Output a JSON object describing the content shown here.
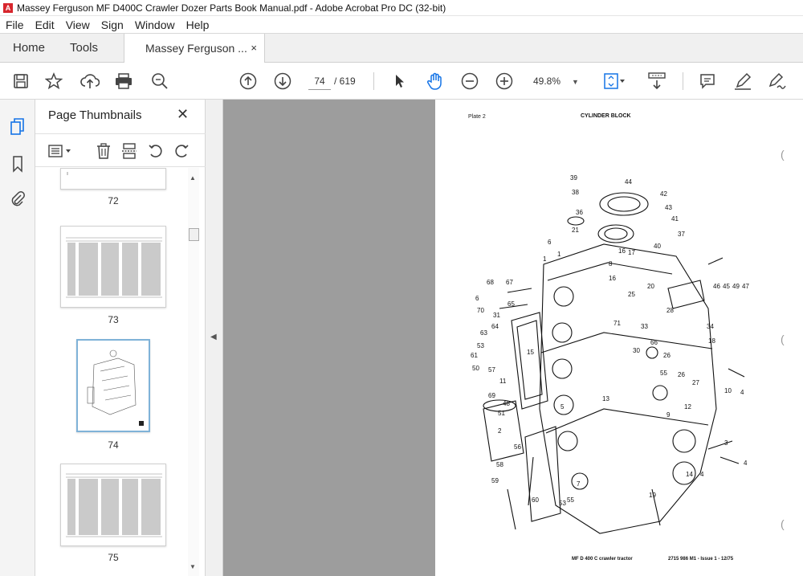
{
  "window": {
    "title": "Massey Ferguson MF D400C Crawler Dozer  Parts Book Manual.pdf - Adobe Acrobat Pro DC (32-bit)",
    "app_icon": "acrobat-icon"
  },
  "menu": [
    "File",
    "Edit",
    "View",
    "Sign",
    "Window",
    "Help"
  ],
  "tabs": {
    "home": "Home",
    "tools": "Tools",
    "document": "Massey Ferguson ...",
    "close": "×"
  },
  "toolbar": {
    "icons": [
      "save-icon",
      "bookmark-star-icon",
      "upload-cloud-icon",
      "print-icon",
      "zoom-search-icon",
      "page-up-icon",
      "page-down-icon",
      "select-pointer-icon",
      "hand-tool-icon",
      "zoom-out-icon",
      "zoom-in-icon",
      "fit-page-icon",
      "scrolling-mode-icon",
      "comment-icon",
      "highlight-pen-icon",
      "sign-icon"
    ],
    "current_page": "74",
    "total_pages": "/ 619",
    "zoom": "49.8%",
    "zoom_caret": "▼"
  },
  "sidebar": {
    "title": "Page Thumbnails",
    "close": "✕",
    "thumbnails": [
      {
        "label": "72"
      },
      {
        "label": "73"
      },
      {
        "label": "74",
        "selected": true
      },
      {
        "label": "75"
      }
    ]
  },
  "document_page": {
    "plate": "Plate 2",
    "heading": "CYLINDER BLOCK",
    "footer_left": "MF D 400 C crawler tractor",
    "footer_right": "2715 986 M1 - Issue 1 - 12/75",
    "callouts": [
      "39",
      "44",
      "38",
      "42",
      "43",
      "36",
      "41",
      "21",
      "37",
      "6",
      "17",
      "16",
      "40",
      "1",
      "8",
      "25",
      "20",
      "68",
      "67",
      "6",
      "70",
      "31",
      "65",
      "66",
      "33",
      "61",
      "53",
      "55",
      "15",
      "63",
      "64",
      "34",
      "18",
      "28",
      "30",
      "26",
      "71",
      "4",
      "10",
      "3",
      "2",
      "56",
      "58",
      "59",
      "60",
      "53",
      "55",
      "7",
      "19",
      "12",
      "27",
      "26",
      "14",
      "4",
      "46",
      "45",
      "49",
      "47",
      "13",
      "9",
      "50",
      "69",
      "57",
      "11",
      "5",
      "48",
      "51",
      "16",
      "4",
      "1"
    ],
    "margin_marks": [
      "(",
      "(",
      "("
    ]
  },
  "colors": {
    "accent": "#d7262d",
    "viewer_bg": "#9d9d9d",
    "selected_thumb": "#dce9f3"
  }
}
